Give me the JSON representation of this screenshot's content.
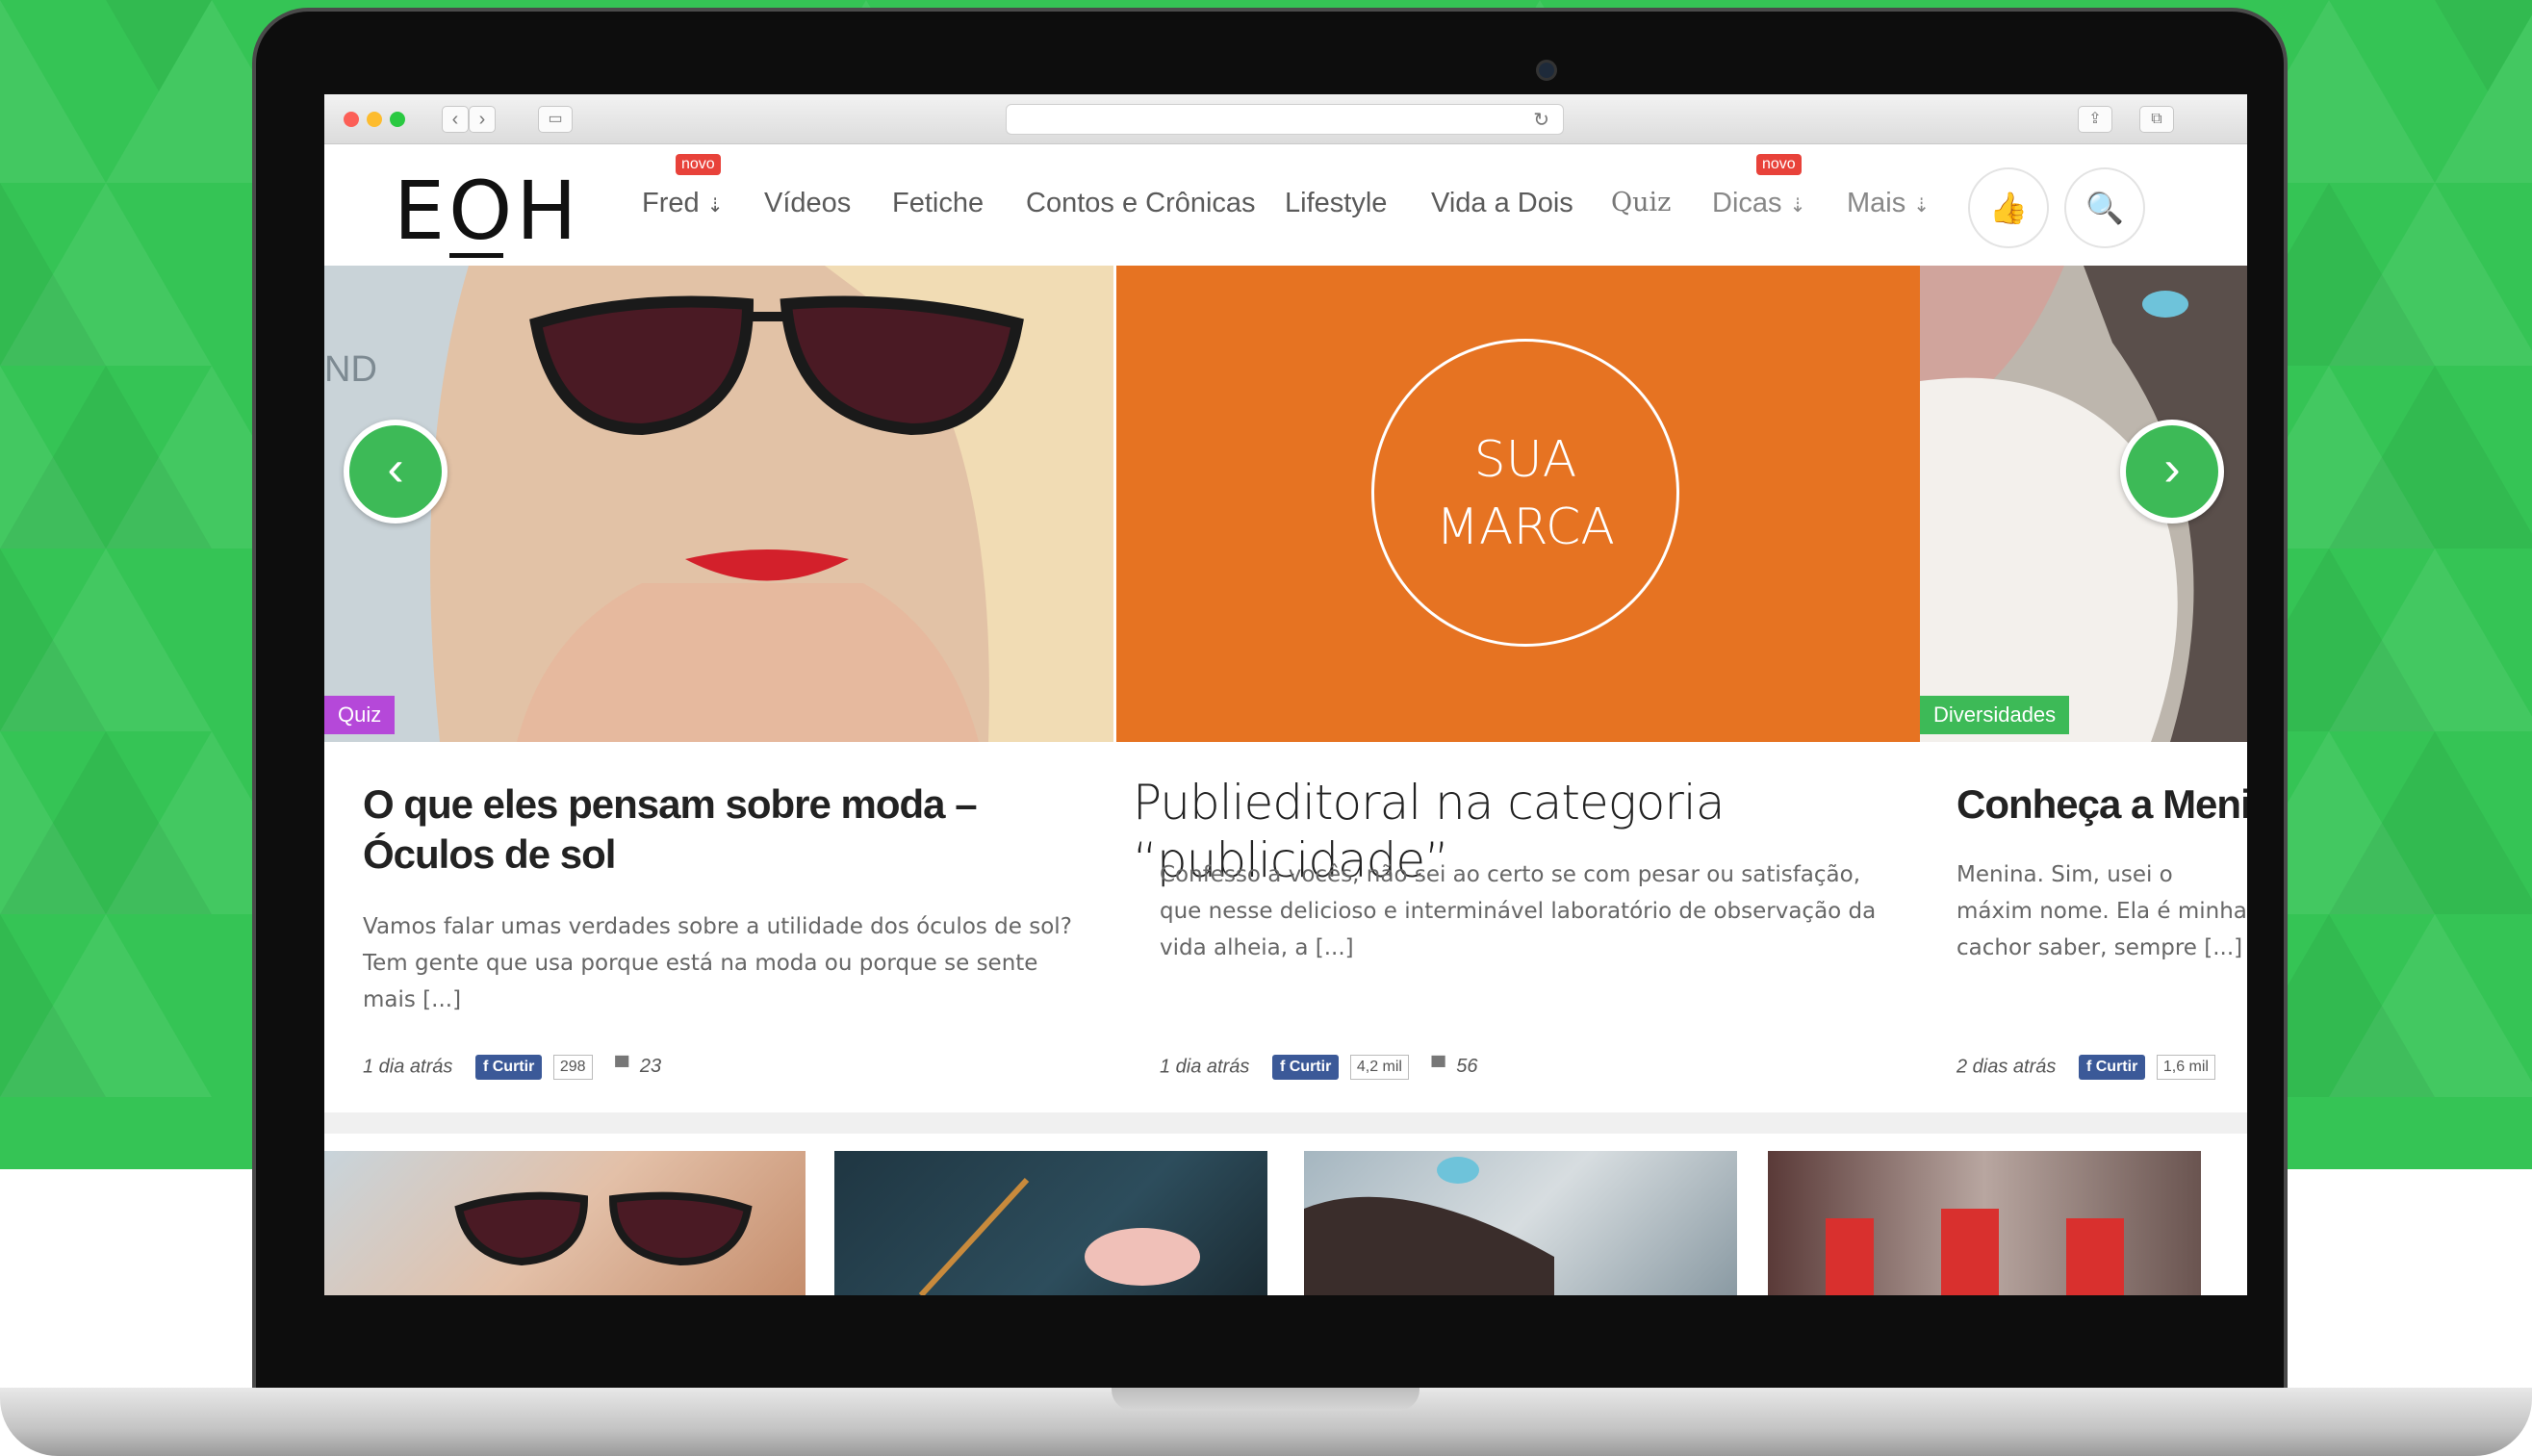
{
  "browser": {
    "reload_icon": "reload-icon"
  },
  "site": {
    "logo": "EOH",
    "nav": [
      {
        "label": "Fred",
        "arrow": "⇣",
        "badge": "novo"
      },
      {
        "label": "Vídeos"
      },
      {
        "label": "Fetiche"
      },
      {
        "label": "Contos e Crônicas"
      },
      {
        "label": "Lifestyle"
      },
      {
        "label": "Vida a Dois"
      },
      {
        "label": "Quiz"
      },
      {
        "label": "Dicas",
        "arrow": "⇣",
        "badge": "novo"
      },
      {
        "label": "Mais",
        "arrow": "⇣"
      }
    ],
    "like_icon": "👍",
    "search_icon": "🔍"
  },
  "slides": [
    {
      "category": "Quiz",
      "category_color": "#b548d9",
      "title": "O que eles pensam sobre moda – Óculos de sol",
      "excerpt": "Vamos falar umas verdades sobre a utilidade dos óculos de sol? Tem gente que usa porque está na moda ou porque se sente mais [...]",
      "time": "1 dia atrás",
      "like_label": "Curtir",
      "likes": "298",
      "comments": "23"
    },
    {
      "brand_line1": "SUA",
      "brand_line2": "MARCA",
      "brand_color": "#e67322",
      "title": "Publieditoral na categoria “publicidade”",
      "excerpt": "Confesso a vocês, não sei ao certo se com pesar ou satisfação, que nesse delicioso e interminável laboratório de observação da vida alheia, a [...]",
      "time": "1 dia atrás",
      "like_label": "Curtir",
      "likes": "4,2 mil",
      "comments": "56"
    },
    {
      "category": "Diversidades",
      "category_color": "#3dba57",
      "title": "Conheça a Menina",
      "excerpt": "Menina. Sim, usei o máxim nome. Ela é minha cachor saber, sempre [...]",
      "time": "2 dias atrás",
      "like_label": "Curtir",
      "likes": "1,6 mil"
    }
  ],
  "arrows": {
    "prev": "‹",
    "next": "›"
  },
  "colors": {
    "background_green": "#35c455",
    "accent_green": "#3dba57",
    "facebook_blue": "#3b5998"
  }
}
